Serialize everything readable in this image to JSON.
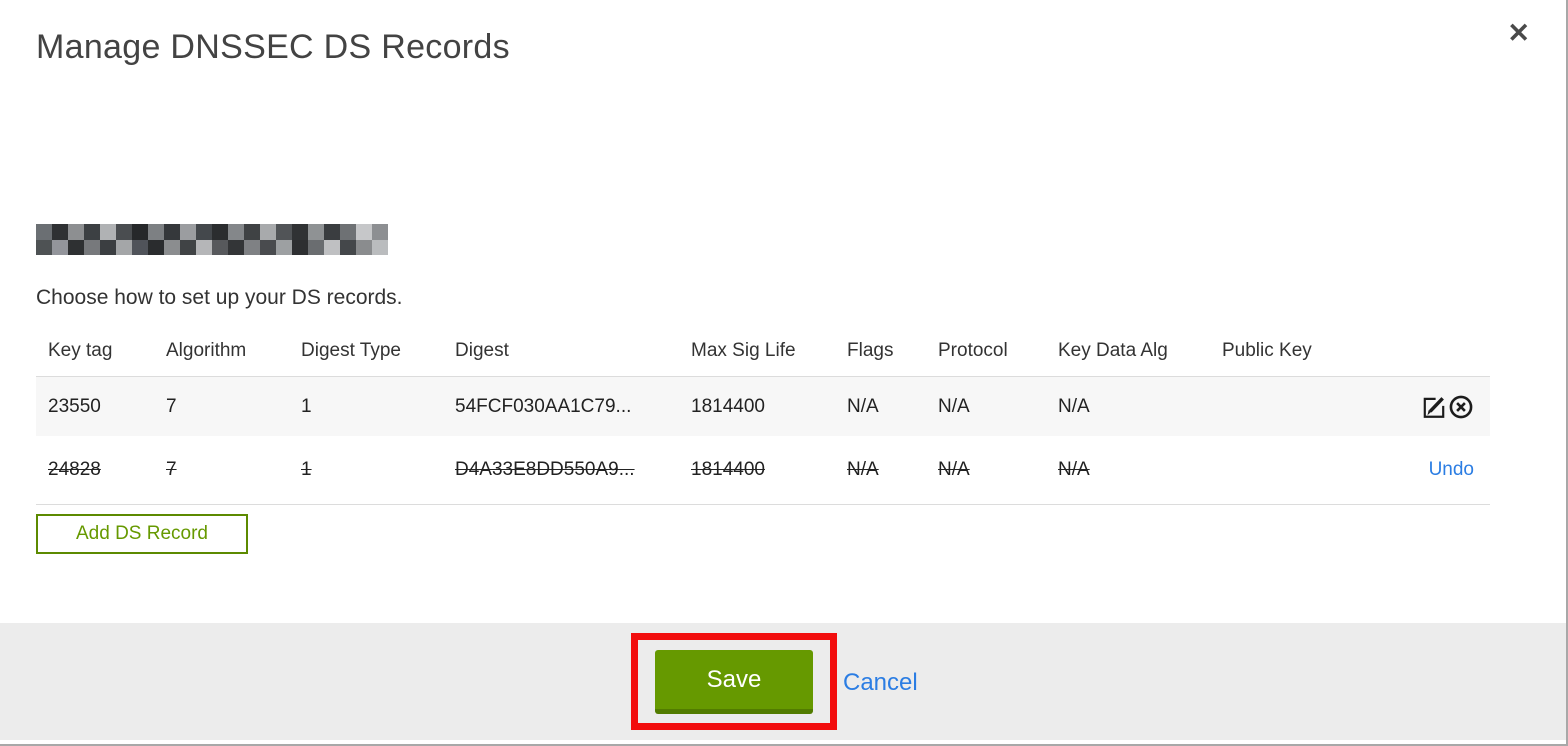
{
  "modal": {
    "title": "Manage DNSSEC DS Records",
    "close_icon": "✕",
    "domain_redacted": true,
    "subtitle": "Choose how to set up your DS records."
  },
  "table": {
    "headers": [
      "Key tag",
      "Algorithm",
      "Digest Type",
      "Digest",
      "Max Sig Life",
      "Flags",
      "Protocol",
      "Key Data Alg",
      "Public Key"
    ],
    "rows": [
      {
        "key_tag": "23550",
        "algorithm": "7",
        "digest_type": "1",
        "digest": "54FCF030AA1C79...",
        "max_sig_life": "1814400",
        "flags": "N/A",
        "protocol": "N/A",
        "key_data_alg": "N/A",
        "public_key": "",
        "state": "normal"
      },
      {
        "key_tag": "24828",
        "algorithm": "7",
        "digest_type": "1",
        "digest": "D4A33E8DD550A9...",
        "max_sig_life": "1814400",
        "flags": "N/A",
        "protocol": "N/A",
        "key_data_alg": "N/A",
        "public_key": "",
        "state": "deleted",
        "undo_label": "Undo"
      }
    ]
  },
  "buttons": {
    "add_ds_record": "Add DS Record",
    "save": "Save",
    "cancel": "Cancel"
  },
  "colors": {
    "accent_green": "#669900",
    "accent_green_dark": "#527c00",
    "green_border": "#5c8a00",
    "link_blue": "#2b7de3",
    "annotation_red": "#f20d0d",
    "footer_bg": "#ececec",
    "row_stripe": "#f7f7f7"
  }
}
